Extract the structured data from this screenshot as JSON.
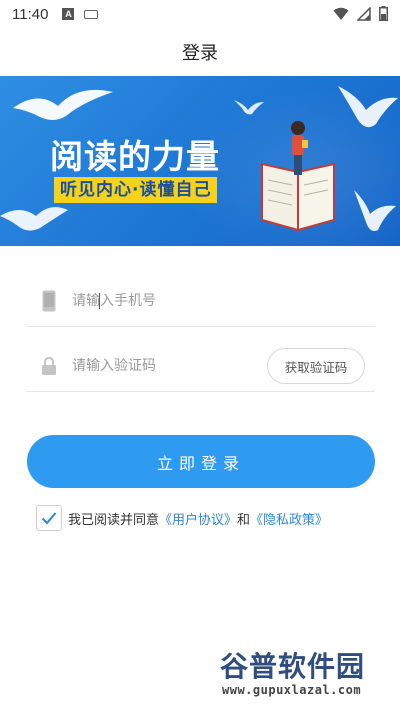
{
  "status_bar": {
    "time": "11:40",
    "notification_letter": "A",
    "icons": [
      "keyboard-icon",
      "wifi-icon",
      "signal-icon",
      "battery-icon"
    ]
  },
  "header": {
    "title": "登录"
  },
  "banner": {
    "title": "阅读的力量",
    "subtitle": "听见内心·读懂自己",
    "colors": {
      "background": "#1f79d6",
      "subtitle_bg": "#f7d21a"
    }
  },
  "form": {
    "phone_placeholder": "请输入手机号",
    "code_placeholder": "请输入验证码",
    "get_code_label": "获取验证码",
    "login_label": "立即登录"
  },
  "agreement": {
    "checked": true,
    "prefix": "我已阅读并同意",
    "user_agreement": "《用户协议》",
    "and": "和",
    "privacy_policy": "《隐私政策》"
  },
  "watermark": {
    "brand": "谷普软件园",
    "url": "www.gupuxlazal.com"
  },
  "colors": {
    "accent": "#2e9af0",
    "link": "#2d86dc"
  }
}
